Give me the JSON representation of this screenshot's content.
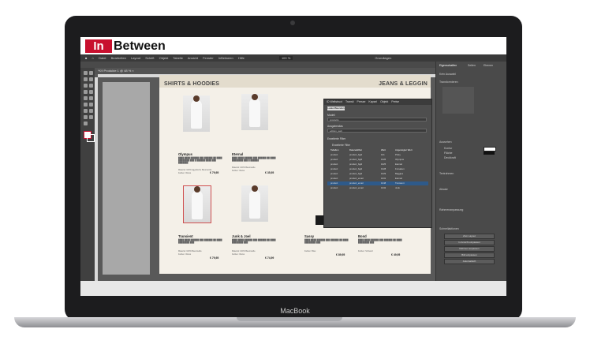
{
  "brand": {
    "logo_left": "In",
    "logo_right": "Between",
    "accent_color": "#c8102e"
  },
  "menu": [
    "Datei",
    "Bearbeiten",
    "Layout",
    "Schrift",
    "Objekt",
    "Tabelle",
    "Ansicht",
    "Fenster",
    "InBetween",
    "Hilfe"
  ],
  "zoom": "100 %",
  "workspace_label": "Grundlagen",
  "doc_tab": "*K9 Produkte 1 @ 48 % ×",
  "left_page": {
    "heading": "SHIRTS & HOODIES",
    "products": [
      {
        "name": "Olympus",
        "material": "Material: 100% ägyptische Baumwolle",
        "colors": "Farben: Weiss",
        "price": "€ 79,95"
      },
      {
        "name": "Eternal",
        "material": "Material: 100% Baumwolle",
        "colors": "Farben: Weiss",
        "price": "€ 35,95"
      },
      {
        "name": "Transient",
        "material": "Material: 100% Baumwolle",
        "colors": "Farben: Weiss",
        "price": "€ 79,95"
      },
      {
        "name": "Junk & Joel",
        "material": "Material: 100% Baumwolle",
        "colors": "Farben: Weiss",
        "price": "€ 74,99"
      }
    ]
  },
  "right_page": {
    "heading": "JEANS & LEGGIN",
    "products": [
      {
        "name": "Sassy",
        "colors": "Farben: Blau",
        "price": "€ 89,95"
      },
      {
        "name": "Bond",
        "colors": "Farben: Schwarz",
        "price": "€ 49,95"
      }
    ]
  },
  "dialog": {
    "tabs": [
      "ID Weltstruct",
      "Transit",
      "Presse",
      "Kapsel",
      "Objekt",
      "Preise",
      "Mehr",
      "Interne",
      "Datei"
    ],
    "load_button": "Laden/Beenden",
    "section_modell": "Modell",
    "modell_value": "products",
    "section_ausgabe": "Ausgabealias",
    "ausgabe_value": "edition_web",
    "section_filter": "Erweiterte Filter",
    "subsection": "Erweiterte Filter",
    "columns": [
      "Tabellen",
      "Datenattribut",
      "Wert",
      "Angezeigter Wert"
    ],
    "rows": [
      [
        "product",
        "product_bgid",
        "101",
        "Pinky"
      ],
      [
        "product",
        "product_bgid",
        "1026",
        "Olympus"
      ],
      [
        "product",
        "product_bgid",
        "1025",
        "Eternal"
      ],
      [
        "product",
        "product_bgid",
        "1028",
        "Forsaken"
      ],
      [
        "product",
        "product_bgid",
        "1029",
        "Baggies"
      ],
      [
        "product",
        "product_email",
        "1031",
        "Eternal"
      ],
      [
        "product",
        "product_email",
        "1048",
        "Transient"
      ],
      [
        "product",
        "product_email",
        "1032",
        "Junk"
      ]
    ]
  },
  "right_panel": {
    "tabs": [
      "Eigenschaften",
      "Seiten",
      "Ebenen"
    ],
    "section1": "Kein Auswahl",
    "section2": "Transformieren",
    "section3": "Aussehen",
    "section4": "Textrahmen",
    "section5": "Absatz",
    "section6": "Rahmenanpassung",
    "section7": "Schnellaktionen",
    "labels": [
      "Kontur",
      "Fläche",
      "Deckkraft"
    ],
    "buttons": [
      "Zum Layout",
      "In Ansicht einpassen",
      "Rahmen anpassen",
      "Bild einpassen",
      "Automatisch"
    ]
  },
  "laptop_label": "MacBook"
}
